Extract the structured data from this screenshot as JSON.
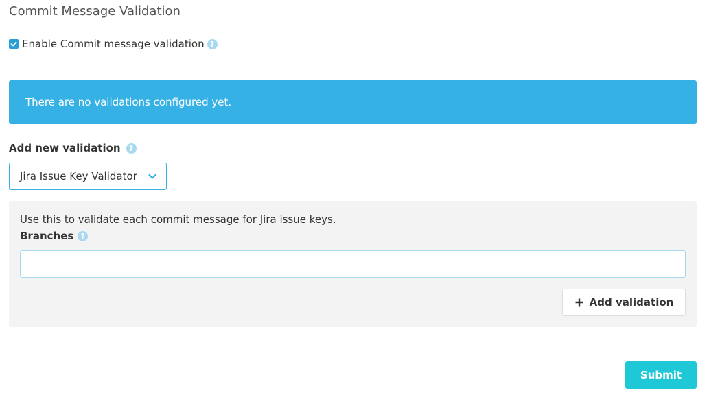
{
  "page": {
    "title": "Commit Message Validation"
  },
  "enable": {
    "label": "Enable Commit message validation",
    "checked": true,
    "help_icon": "question-circle-icon"
  },
  "alert": {
    "message": "There are no validations configured yet."
  },
  "add_validation": {
    "label": "Add new validation",
    "help_icon": "question-circle-icon",
    "selected_validator": "Jira Issue Key Validator",
    "dropdown_icon": "chevron-down-icon"
  },
  "panel": {
    "description": "Use this to validate each commit message for Jira issue keys.",
    "branches_label": "Branches",
    "branches_value": "",
    "add_button_label": "Add validation",
    "add_button_icon": "plus-icon"
  },
  "footer": {
    "submit_label": "Submit"
  },
  "colors": {
    "accent_blue": "#35b1e5",
    "checkbox_blue": "#2a9fd6",
    "help_icon": "#a9d8f0",
    "submit_teal": "#1fc8d6",
    "panel_bg": "#f3f3f3"
  }
}
